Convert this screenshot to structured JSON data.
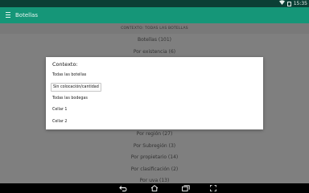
{
  "status_bar": {
    "time": "15:35"
  },
  "app_bar": {
    "title": "Botellas"
  },
  "list": {
    "header": "CONTEXTO: TODAS LAS BOTELLAS",
    "items": [
      "Botellas (101)",
      "Por existencia (6)",
      "",
      "",
      "",
      "",
      "",
      "Por región (27)",
      "Por Subregión (3)",
      "Por propietario (14)",
      "Por clasificación (2)",
      "Por uva (13)"
    ]
  },
  "dialog": {
    "title": "Contexto:",
    "options": [
      "Todas las botellas",
      "Sin colocación/cantidad",
      "Todas las bodegas",
      "Cellar 1",
      "Cellar 2"
    ],
    "selected_index": 1
  },
  "colors": {
    "status_bar": "#0b3f35",
    "app_bar": "#159678",
    "overlay": "rgba(0,0,0,0.5)"
  },
  "nav_bar": {
    "icons": [
      "back-icon",
      "home-icon",
      "recents-icon",
      "screenshot-icon"
    ]
  }
}
